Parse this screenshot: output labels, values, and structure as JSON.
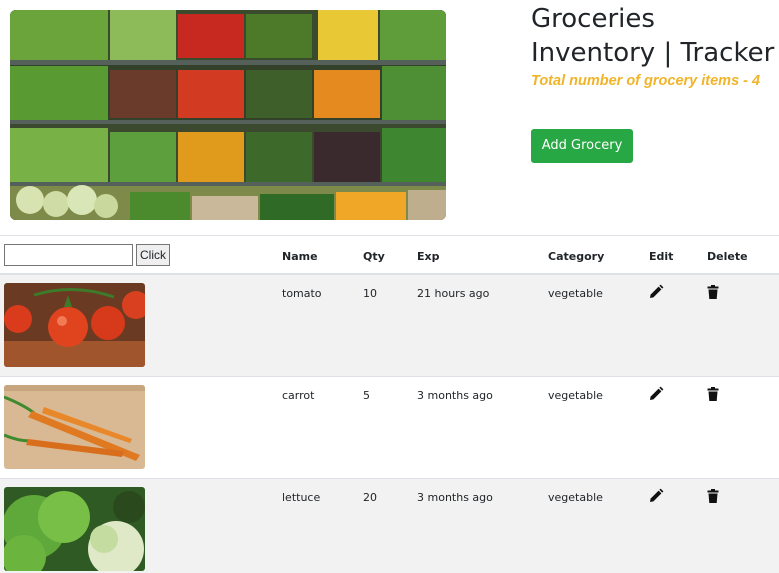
{
  "header": {
    "title": "Groceries\nInventory | Tracker",
    "item_count_text": "Total number of grocery items - 4",
    "add_button_label": "Add Grocery"
  },
  "search": {
    "value": "",
    "button_label": "Click"
  },
  "table": {
    "headers": {
      "name": "Name",
      "qty": "Qty",
      "exp": "Exp",
      "category": "Category",
      "edit": "Edit",
      "delete": "Delete"
    },
    "rows": [
      {
        "name": "tomato",
        "qty": "10",
        "exp": "21 hours ago",
        "category": "vegetable",
        "image": "tomato-photo"
      },
      {
        "name": "carrot",
        "qty": "5",
        "exp": "3 months ago",
        "category": "vegetable",
        "image": "carrot-photo"
      },
      {
        "name": "lettuce",
        "qty": "20",
        "exp": "3 months ago",
        "category": "vegetable",
        "image": "lettuce-photo"
      }
    ]
  },
  "icons": {
    "edit": "pencil-icon",
    "delete": "trash-icon"
  },
  "colors": {
    "accent_yellow": "#f0b429",
    "button_green": "#28a745",
    "stripe": "#f2f2f2"
  }
}
